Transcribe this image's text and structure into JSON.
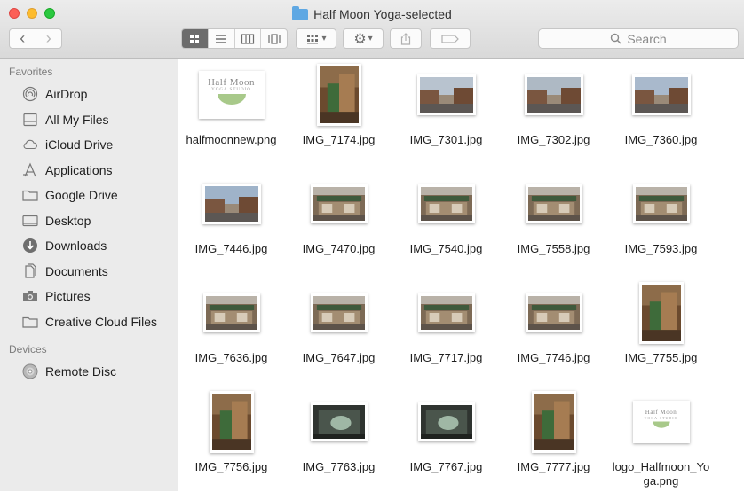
{
  "window": {
    "title": "Half Moon Yoga-selected"
  },
  "toolbar": {
    "back": "‹",
    "forward": "›",
    "view_modes": [
      "icon-view",
      "list-view",
      "column-view",
      "cover-flow-view"
    ],
    "arrange_label": "▾",
    "action_label": "▾",
    "search_placeholder": "Search"
  },
  "sidebar": {
    "favorites_header": "Favorites",
    "favorites": [
      {
        "label": "AirDrop",
        "icon": "airdrop-icon"
      },
      {
        "label": "All My Files",
        "icon": "all-files-icon"
      },
      {
        "label": "iCloud Drive",
        "icon": "cloud-icon"
      },
      {
        "label": "Applications",
        "icon": "applications-icon"
      },
      {
        "label": "Google Drive",
        "icon": "folder-icon"
      },
      {
        "label": "Desktop",
        "icon": "desktop-icon"
      },
      {
        "label": "Downloads",
        "icon": "downloads-icon"
      },
      {
        "label": "Documents",
        "icon": "documents-icon"
      },
      {
        "label": "Pictures",
        "icon": "camera-icon"
      },
      {
        "label": "Creative Cloud Files",
        "icon": "folder-icon"
      }
    ],
    "devices_header": "Devices",
    "devices": [
      {
        "label": "Remote Disc",
        "icon": "disc-icon"
      }
    ]
  },
  "files": [
    {
      "name": "halfmoonnew.png",
      "kind": "logo"
    },
    {
      "name": "IMG_7174.jpg",
      "kind": "portrait"
    },
    {
      "name": "IMG_7301.jpg",
      "kind": "street"
    },
    {
      "name": "IMG_7302.jpg",
      "kind": "street"
    },
    {
      "name": "IMG_7360.jpg",
      "kind": "street"
    },
    {
      "name": "IMG_7446.jpg",
      "kind": "street"
    },
    {
      "name": "IMG_7470.jpg",
      "kind": "storefront"
    },
    {
      "name": "IMG_7540.jpg",
      "kind": "storefront"
    },
    {
      "name": "IMG_7558.jpg",
      "kind": "storefront"
    },
    {
      "name": "IMG_7593.jpg",
      "kind": "storefront"
    },
    {
      "name": "IMG_7636.jpg",
      "kind": "storefront"
    },
    {
      "name": "IMG_7647.jpg",
      "kind": "storefront"
    },
    {
      "name": "IMG_7717.jpg",
      "kind": "storefront"
    },
    {
      "name": "IMG_7746.jpg",
      "kind": "storefront"
    },
    {
      "name": "IMG_7755.jpg",
      "kind": "portrait"
    },
    {
      "name": "IMG_7756.jpg",
      "kind": "portrait"
    },
    {
      "name": "IMG_7763.jpg",
      "kind": "dark"
    },
    {
      "name": "IMG_7767.jpg",
      "kind": "dark"
    },
    {
      "name": "IMG_7777.jpg",
      "kind": "portrait"
    },
    {
      "name": "logo_Halfmoon_Yoga.png",
      "kind": "logo-small"
    }
  ],
  "logo_text": {
    "line1": "Half Moon",
    "line2": "YOGA STUDIO"
  }
}
